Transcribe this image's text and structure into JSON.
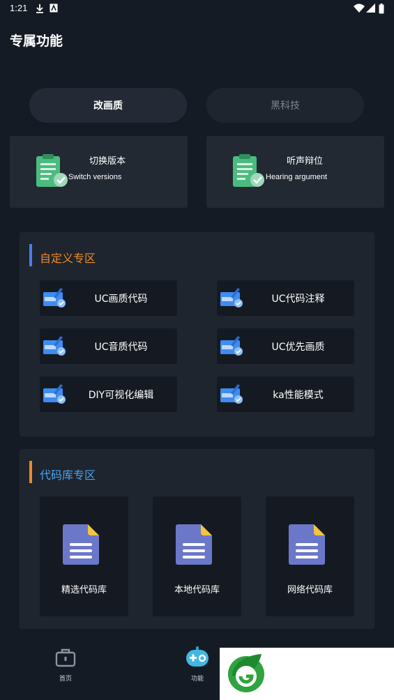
{
  "status": {
    "time": "1:21"
  },
  "header": {
    "title": "专属功能"
  },
  "segments": [
    {
      "label": "改画质",
      "active": true
    },
    {
      "label": "黑科技",
      "active": false
    }
  ],
  "feature_cards": [
    {
      "title": "切换版本",
      "subtitle": "Switch versions"
    },
    {
      "title": "听声辩位",
      "subtitle": "Hearing argument"
    }
  ],
  "custom_zone": {
    "title": "自定义专区",
    "accent": "#f08a24",
    "bar_color": "#4a7cf0",
    "items": [
      "UC画质代码",
      "UC代码注释",
      "UC音质代码",
      "UC优先画质",
      "DIY可视化编辑",
      "ka性能模式"
    ]
  },
  "library_zone": {
    "title": "代码库专区",
    "accent": "#4aa3f0",
    "bar_color": "#f08a24",
    "items": [
      "精选代码库",
      "本地代码库",
      "网络代码库"
    ]
  },
  "bottom_nav": [
    {
      "label": "首页",
      "icon": "briefcase-icon"
    },
    {
      "label": "功能",
      "icon": "gamepad-icon"
    }
  ],
  "colors": {
    "background": "#151b24",
    "card": "#222933",
    "clipboard_green": "#4cbb7f",
    "doc_purple": "#6b78c9",
    "doc_corner": "#f5c43a"
  }
}
